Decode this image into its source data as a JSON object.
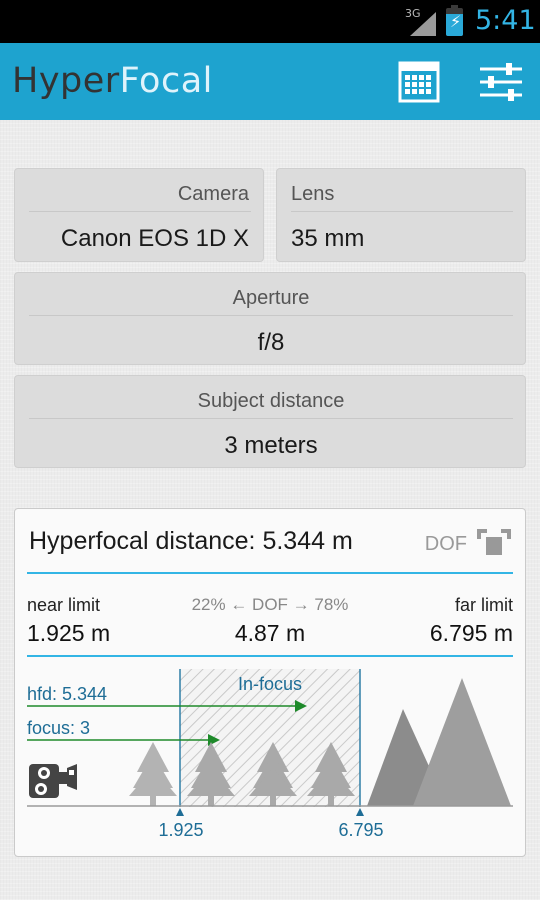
{
  "status_bar": {
    "network": "3G",
    "time": "5:41",
    "accent": "#33b5e5"
  },
  "app": {
    "title_part1": "Hyper",
    "title_part2": "Focal",
    "bar_color": "#1ea3cf",
    "actions": [
      "calendar-grid-icon",
      "settings-sliders-icon"
    ]
  },
  "settings": {
    "camera": {
      "label": "Camera",
      "value": "Canon EOS 1D X"
    },
    "lens": {
      "label": "Lens",
      "value": "35 mm"
    },
    "aperture": {
      "label": "Aperture",
      "value": "f/8"
    },
    "subject_distance": {
      "label": "Subject distance",
      "value": "3 meters"
    }
  },
  "result": {
    "hyperfocal": "Hyperfocal distance: 5.344 m",
    "dof_toggle": "DOF",
    "near_label": "near limit",
    "near_value": "1.925 m",
    "dof_label": "22% ← DOF → 78%",
    "dof_value": "4.87 m",
    "far_label": "far limit",
    "far_value": "6.795 m"
  },
  "diagram": {
    "infocus_label": "In-focus",
    "hfd_label": "hfd: 5.344",
    "focus_label": "focus: 3",
    "near_tick": "1.925",
    "far_tick": "6.795",
    "line_color": "#1e8a2a"
  }
}
